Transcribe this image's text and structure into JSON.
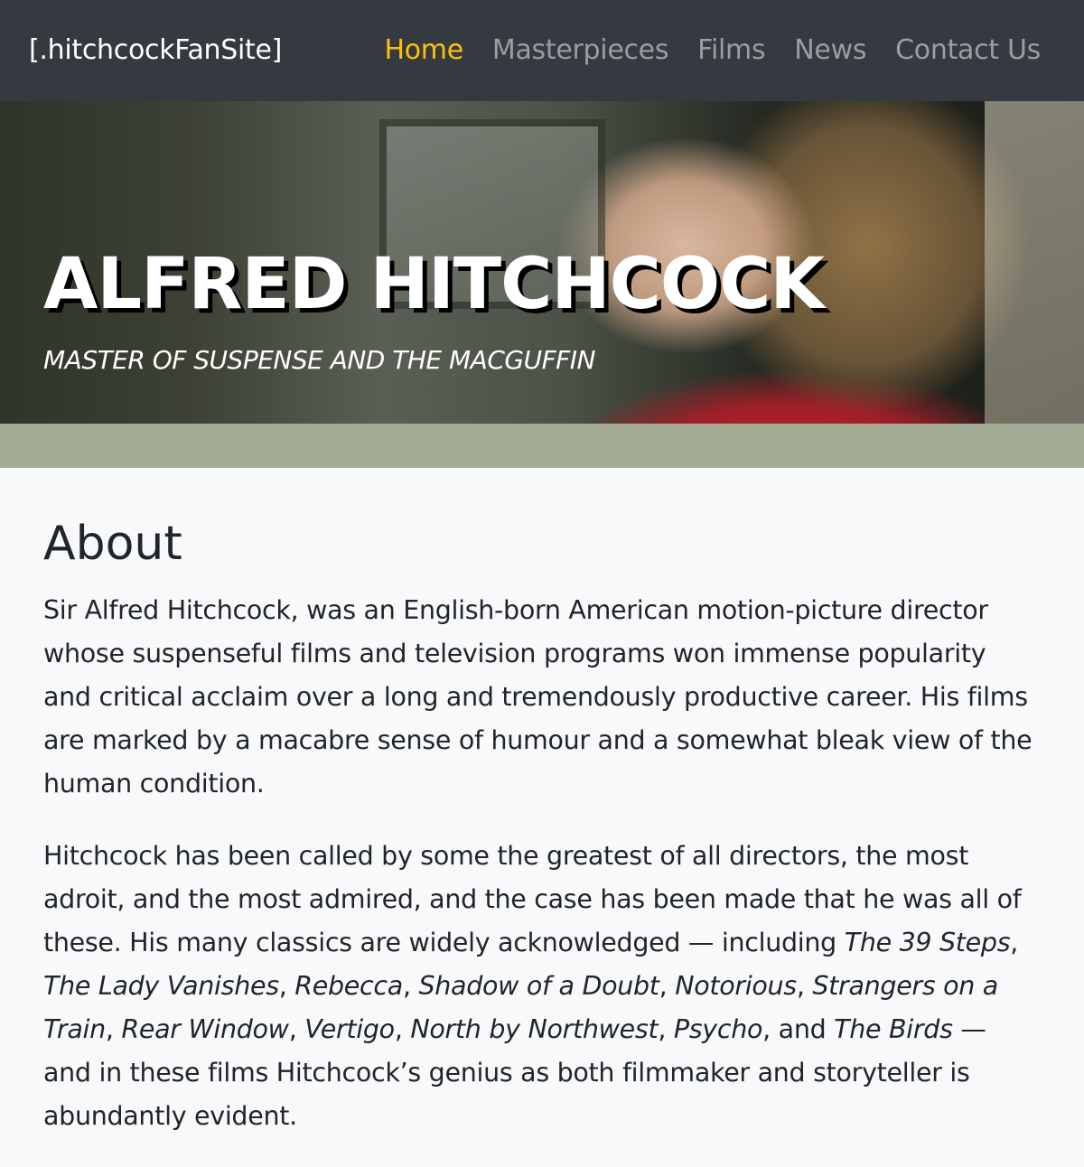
{
  "navbar": {
    "brand": "[.hitchcockFanSite]",
    "links": [
      {
        "label": "Home",
        "active": true
      },
      {
        "label": "Masterpieces",
        "active": false
      },
      {
        "label": "Films",
        "active": false
      },
      {
        "label": "News",
        "active": false
      },
      {
        "label": "Contact Us",
        "active": false
      }
    ],
    "active_color": "#ffc107",
    "background": "#343a40"
  },
  "hero": {
    "title": "ALFRED HITCHCOCK",
    "subtitle": "MASTER OF SUSPENSE AND THE MACGUFFIN"
  },
  "about": {
    "heading": "About",
    "paragraph1": "Sir Alfred Hitchcock, was an English-born American motion-picture director whose suspenseful films and television programs won immense popularity and critical acclaim over a long and tremendously productive career. His films are marked by a macabre sense of humour and a somewhat bleak view of the human condition.",
    "paragraph2": {
      "intro": "Hitchcock has been called by some the greatest of all directors, the most adroit, and the most admired, and the case has been made that he was all of these. His many classics are widely acknowledged — including ",
      "films": [
        "The 39 Steps",
        "The Lady Vanishes",
        "Rebecca",
        "Shadow of a Doubt",
        "Notorious",
        "Strangers on a Train",
        "Rear Window",
        "Vertigo",
        "North by Northwest",
        "Psycho",
        "The Birds"
      ],
      "sep": ", ",
      "and": "and ",
      "outro": " — and in these films Hitchcock’s genius as both filmmaker and storyteller is abundantly evident."
    }
  }
}
